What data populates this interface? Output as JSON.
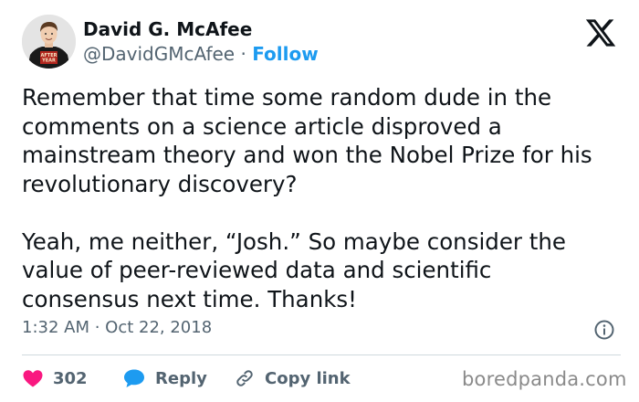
{
  "author": {
    "name": "David G. McAfee",
    "handle": "@DavidGMcAfee",
    "separator": "·",
    "follow_label": "Follow",
    "avatar_shirt_text": "AFTER YEAR ZERO"
  },
  "tweet": {
    "paragraph1": [
      "Remember that time some random dude in the",
      "comments on a science article disproved a",
      "mainstream theory and won the Nobel Prize for his",
      "revolutionary discovery?"
    ],
    "paragraph2": [
      "Yeah, me neither, “Josh.” So maybe consider the",
      "value of peer-reviewed data and scientific",
      "consensus next time. Thanks!"
    ],
    "timestamp": "1:32 AM · Oct 22, 2018"
  },
  "actions": {
    "like_count": "302",
    "reply_label": "Reply",
    "copy_label": "Copy link"
  },
  "watermark": "boredpanda.com",
  "colors": {
    "text": "#0f1419",
    "muted": "#536471",
    "accent": "#1d9bf0",
    "like": "#f91880",
    "divider": "#cfd9de"
  },
  "icons": {
    "platform": "x-logo-icon",
    "info": "info-icon",
    "like": "heart-icon",
    "reply": "speech-bubble-icon",
    "copy": "link-icon"
  }
}
